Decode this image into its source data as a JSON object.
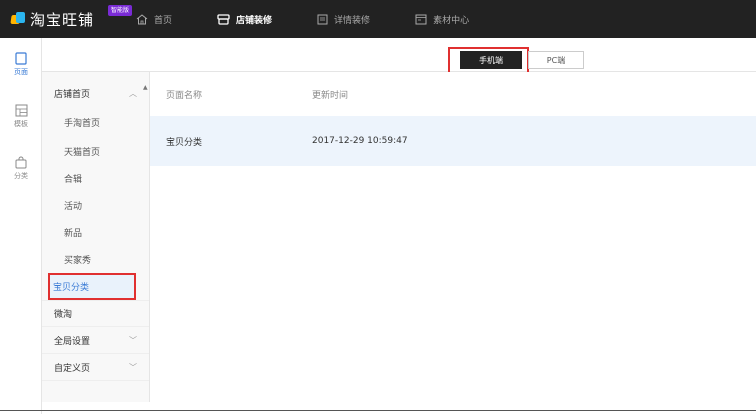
{
  "app": {
    "title": "淘宝旺铺",
    "badge": "智能版"
  },
  "nav": [
    {
      "label": "首页"
    },
    {
      "label": "店铺装修"
    },
    {
      "label": "详情装修"
    },
    {
      "label": "素材中心"
    }
  ],
  "rail": [
    {
      "label": "页面"
    },
    {
      "label": "模板"
    },
    {
      "label": "分类"
    }
  ],
  "toggle": {
    "mobile": "手机端",
    "pc": "PC端"
  },
  "menu": {
    "group_label": "店铺首页",
    "sub_items": [
      "手淘首页",
      "天猫首页",
      "合辑",
      "活动",
      "新品",
      "买家秀"
    ],
    "selected_label": "宝贝分类",
    "items": [
      {
        "label": "微淘"
      },
      {
        "label": "全局设置"
      },
      {
        "label": "自定义页"
      }
    ]
  },
  "table": {
    "headers": [
      "页面名称",
      "更新时间"
    ],
    "rows": [
      {
        "name": "宝贝分类",
        "time": "2017-12-29 10:59:47"
      }
    ]
  },
  "colors": {
    "topbar": "#222222",
    "accent": "#3a7bd5",
    "highlight_border": "#e03030",
    "badge": "#7a2bd6"
  }
}
